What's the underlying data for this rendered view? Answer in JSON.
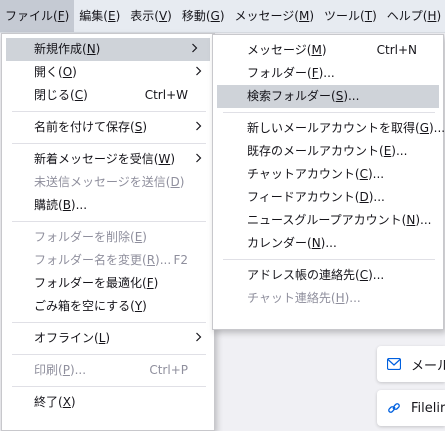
{
  "menubar": [
    {
      "label": "ファイル(",
      "key": "F",
      "tail": ")",
      "active": true
    },
    {
      "label": "編集(",
      "key": "E",
      "tail": ")"
    },
    {
      "label": "表示(",
      "key": "V",
      "tail": ")"
    },
    {
      "label": "移動(",
      "key": "G",
      "tail": ")"
    },
    {
      "label": "メッセージ(",
      "key": "M",
      "tail": ")"
    },
    {
      "label": "ツール(",
      "key": "T",
      "tail": ")"
    },
    {
      "label": "ヘルプ(",
      "key": "H",
      "tail": ")"
    }
  ],
  "file_menu": {
    "items": [
      {
        "label": "新規作成(",
        "key": "N",
        "tail": ")",
        "submenu": true,
        "highlighted": true
      },
      {
        "label": "開く(",
        "key": "O",
        "tail": ")",
        "submenu": true
      },
      {
        "label": "閉じる(",
        "key": "C",
        "tail": ")",
        "shortcut": "Ctrl+W"
      },
      {
        "sep": true
      },
      {
        "label": "名前を付けて保存(",
        "key": "S",
        "tail": ")",
        "submenu": true
      },
      {
        "sep": true
      },
      {
        "label": "新着メッセージを受信(",
        "key": "W",
        "tail": ")",
        "submenu": true
      },
      {
        "label": "未送信メッセージを送信(",
        "key": "D",
        "tail": ")",
        "disabled": true
      },
      {
        "label": "購読(",
        "key": "B",
        "tail": ")..."
      },
      {
        "sep": true
      },
      {
        "label": "フォルダーを削除(",
        "key": "E",
        "tail": ")",
        "disabled": true
      },
      {
        "label": "フォルダー名を変更(",
        "key": "R",
        "tail": ")...",
        "disabled": true,
        "shortcut": "F2"
      },
      {
        "label": "フォルダーを最適化(",
        "key": "F",
        "tail": ")"
      },
      {
        "label": "ごみ箱を空にする(",
        "key": "Y",
        "tail": ")"
      },
      {
        "sep": true
      },
      {
        "label": "オフライン(",
        "key": "L",
        "tail": ")",
        "submenu": true
      },
      {
        "sep": true
      },
      {
        "label": "印刷(",
        "key": "P",
        "tail": ")...",
        "disabled": true,
        "shortcut": "Ctrl+P"
      },
      {
        "sep": true
      },
      {
        "label": "終了(",
        "key": "X",
        "tail": ")"
      }
    ]
  },
  "new_submenu": {
    "items": [
      {
        "label": "メッセージ(",
        "key": "M",
        "tail": ")",
        "shortcut": "Ctrl+N"
      },
      {
        "label": "フォルダー(",
        "key": "F",
        "tail": ")..."
      },
      {
        "label": "検索フォルダー(",
        "key": "S",
        "tail": ")...",
        "highlighted": true
      },
      {
        "sep": true
      },
      {
        "label": "新しいメールアカウントを取得(",
        "key": "G",
        "tail": ")..."
      },
      {
        "label": "既存のメールアカウント(",
        "key": "E",
        "tail": ")..."
      },
      {
        "label": "チャットアカウント(",
        "key": "C",
        "tail": ")..."
      },
      {
        "label": "フィードアカウント(",
        "key": "D",
        "tail": ")..."
      },
      {
        "label": "ニュースグループアカウント(",
        "key": "N",
        "tail": ")..."
      },
      {
        "label": "カレンダー(",
        "key": "N",
        "tail": ")..."
      },
      {
        "sep": true
      },
      {
        "label": "アドレス帳の連絡先(",
        "key": "C",
        "tail": ")..."
      },
      {
        "label": "チャット連絡先(",
        "key": "H",
        "tail": ")...",
        "disabled": true
      }
    ]
  },
  "background_cards": [
    {
      "text": "メール",
      "icon": "mail-icon"
    },
    {
      "text": "Filelir",
      "icon": "link-icon"
    }
  ],
  "colors": {
    "accent": "#0060df",
    "highlight": "#cfd3d9"
  }
}
